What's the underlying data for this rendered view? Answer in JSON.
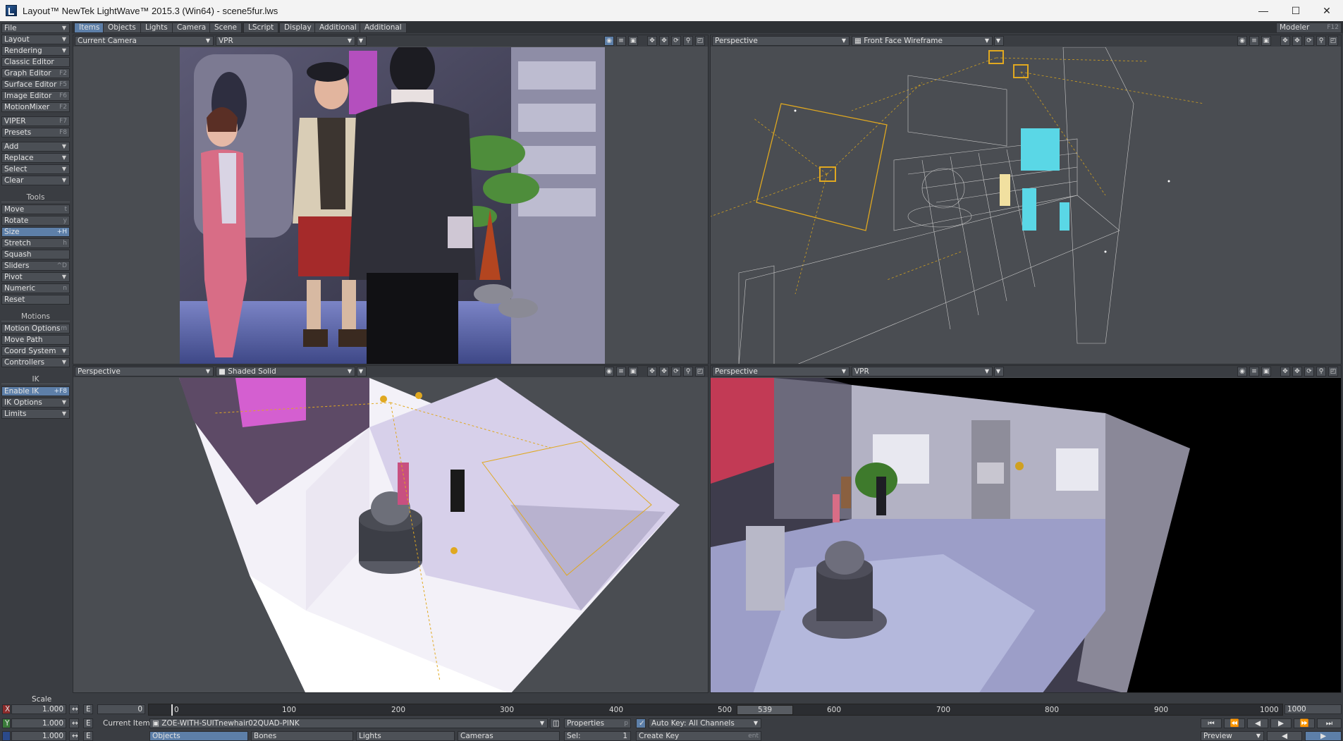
{
  "window": {
    "title": "Layout™ NewTek LightWave™ 2015.3 (Win64) - scene5fur.lws"
  },
  "menu": {
    "file": "File",
    "layout": "Layout",
    "rendering": "Rendering",
    "classic_editor": "Classic Editor",
    "graph_editor": "Graph Editor",
    "graph_editor_sc": "F2",
    "surface_editor": "Surface Editor",
    "surface_editor_sc": "F5",
    "image_editor": "Image Editor",
    "image_editor_sc": "F6",
    "motionmixer": "MotionMixer",
    "motionmixer_sc": "F2",
    "viper": "VIPER",
    "viper_sc": "F7",
    "presets": "Presets",
    "presets_sc": "F8",
    "add": "Add",
    "replace": "Replace",
    "select": "Select",
    "clear": "Clear",
    "tools_head": "Tools",
    "move": "Move",
    "move_sc": "t",
    "rotate": "Rotate",
    "rotate_sc": "y",
    "size": "Size",
    "size_sc": "+H",
    "stretch": "Stretch",
    "stretch_sc": "h",
    "squash": "Squash",
    "sliders": "Sliders",
    "sliders_sc": "^D",
    "pivot": "Pivot",
    "numeric": "Numeric",
    "numeric_sc": "n",
    "reset": "Reset",
    "motions_head": "Motions",
    "motion_options": "Motion Options",
    "motion_options_sc": "m",
    "move_path": "Move Path",
    "coord_system": "Coord System",
    "controllers": "Controllers",
    "ik_head": "IK",
    "enable_ik": "Enable IK",
    "enable_ik_sc": "+F8",
    "ik_options": "IK Options",
    "limits": "Limits"
  },
  "tabs": [
    "Items",
    "Objects",
    "Lights",
    "Camera",
    "Scene",
    "LScript",
    "Display",
    "Additional",
    "Additional"
  ],
  "modeler": {
    "label": "Modeler",
    "sc": "F12"
  },
  "viewports": {
    "tl": {
      "view": "Current Camera",
      "mode": "VPR"
    },
    "tr": {
      "view": "Perspective",
      "mode": "Front Face Wireframe"
    },
    "bl": {
      "view": "Perspective",
      "mode": "Shaded Solid"
    },
    "br": {
      "view": "Perspective",
      "mode": "VPR"
    }
  },
  "bottom": {
    "scale_label": "Scale",
    "x_label": "X",
    "x_val": "1.000",
    "y_label": "Y",
    "y_val": "1.000",
    "z_val": "1.000",
    "e_label": "E",
    "frame_start": "0",
    "current_item_label": "Current Item",
    "current_item": "ZOE-WITH-SUITnewhair02QUAD-PINK",
    "objects": "Objects",
    "bones": "Bones",
    "lights": "Lights",
    "cameras": "Cameras",
    "properties": "Properties",
    "properties_sc": "p",
    "sel_label": "Sel:",
    "sel_val": "1",
    "auto_key": "Auto Key: All Channels",
    "create_key": "Create Key",
    "create_key_sc": "ent",
    "current_frame": "539",
    "end_frame": "1000",
    "preview": "Preview",
    "ticks": [
      "0",
      "100",
      "200",
      "300",
      "400",
      "500",
      "600",
      "700",
      "800",
      "900",
      "1000"
    ]
  }
}
